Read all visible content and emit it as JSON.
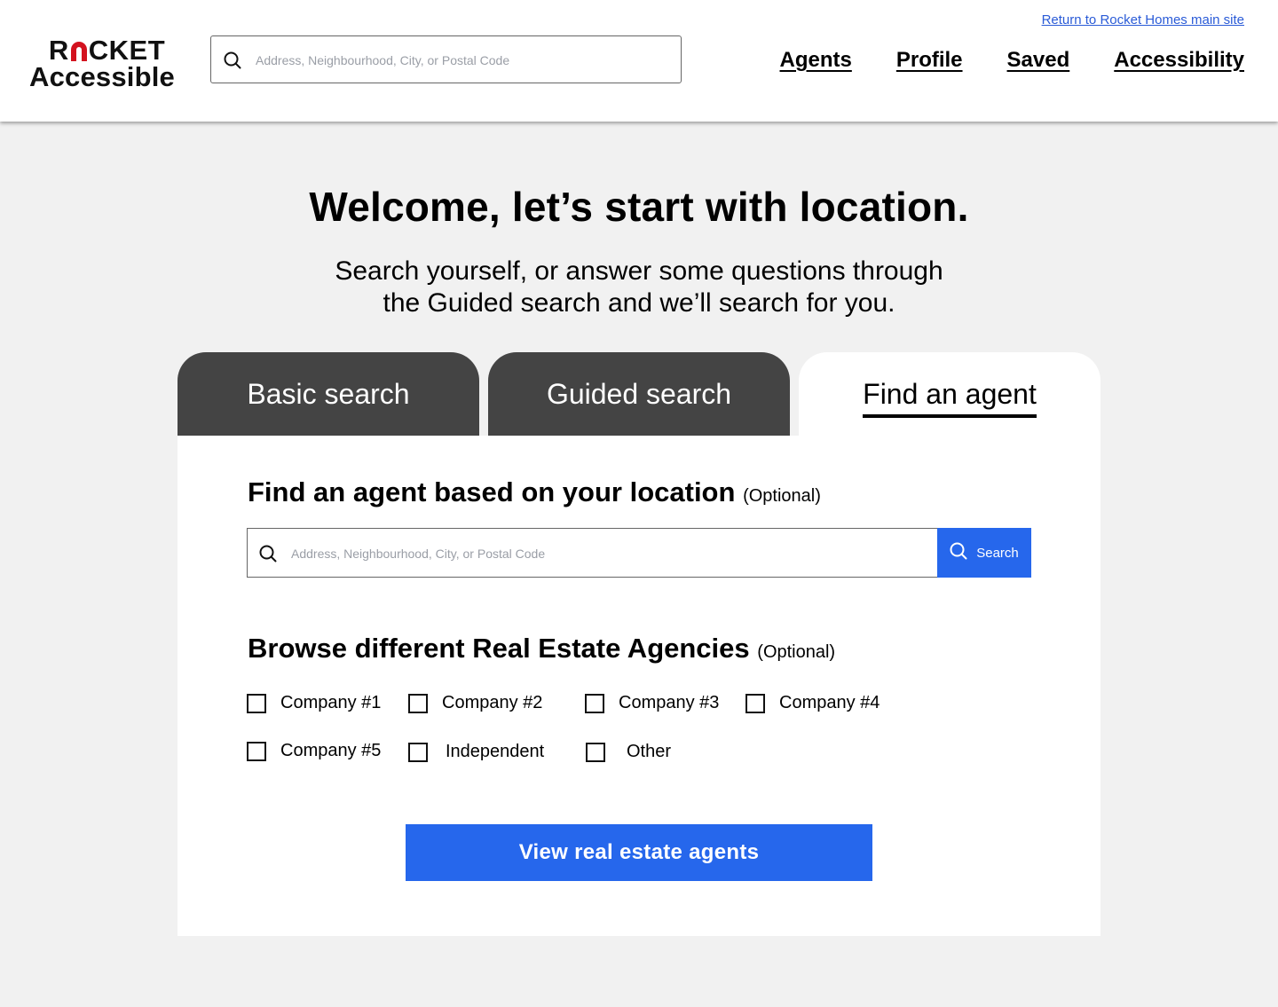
{
  "header": {
    "logo": {
      "line1_pre": "R",
      "line1_post": "CKET",
      "line2": "Accessible"
    },
    "search": {
      "placeholder": "Address, Neighbourhood, City, or Postal Code"
    },
    "return_link": "Return to Rocket Homes main site",
    "nav": [
      "Agents",
      "Profile",
      "Saved",
      "Accessibility"
    ]
  },
  "hero": {
    "title": "Welcome, let’s start with location.",
    "subtitle_line1": "Search yourself, or answer some questions through",
    "subtitle_line2": "the Guided search and we’ll search for you."
  },
  "tabs": [
    {
      "label": "Basic search",
      "active": false
    },
    {
      "label": "Guided search",
      "active": false
    },
    {
      "label": "Find an agent",
      "active": true
    }
  ],
  "agent_panel": {
    "location_title": "Find an agent based on your location",
    "location_optional": "(Optional)",
    "search_placeholder": "Address, Neighbourhood, City, or Postal Code",
    "search_button": "Search",
    "agencies_title": "Browse different Real Estate Agencies",
    "agencies_optional": "(Optional)",
    "agencies": [
      "Company #1",
      "Company #2",
      "Company #3",
      "Company #4",
      "Company #5",
      "Independent",
      "Other"
    ],
    "cta": "View real estate agents"
  },
  "colors": {
    "accent": "#2667ec",
    "tab_inactive": "#444444",
    "link": "#2a5bd7",
    "logo_red": "#d3121f",
    "page_bg": "#f1f1f1"
  },
  "icons": {
    "search": "search-icon"
  }
}
